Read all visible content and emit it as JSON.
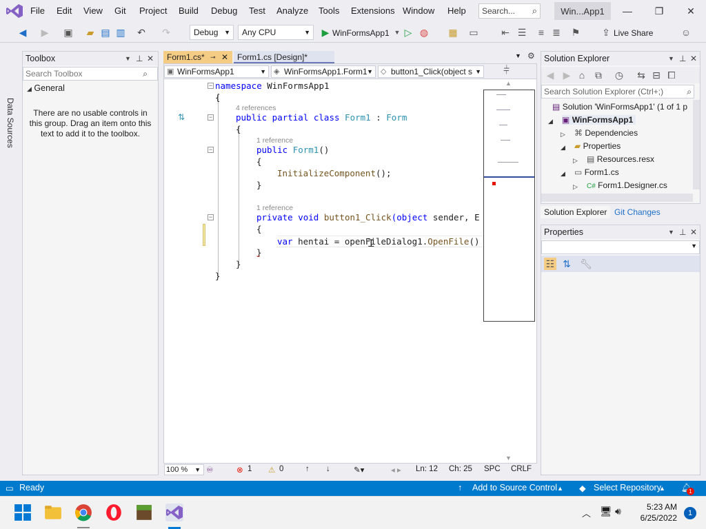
{
  "menubar": {
    "items": [
      "File",
      "Edit",
      "View",
      "Git",
      "Project",
      "Build",
      "Debug",
      "Test",
      "Analyze",
      "Tools",
      "Extensions",
      "Window",
      "Help"
    ],
    "search_placeholder": "Search...",
    "solution_badge": "Win...App1"
  },
  "toolbar": {
    "config": "Debug",
    "platform": "Any CPU",
    "run_target": "WinFormsApp1",
    "live_share": "Live Share"
  },
  "left_strip": {
    "label": "Data Sources"
  },
  "toolbox": {
    "title": "Toolbox",
    "search_placeholder": "Search Toolbox",
    "group": "General",
    "empty_message": "There are no usable controls in this group. Drag an item onto this text to add it to the toolbox."
  },
  "editor": {
    "tabs": [
      {
        "label": "Form1.cs*"
      },
      {
        "label": "Form1.cs [Design]*"
      }
    ],
    "nav": {
      "project": "WinFormsApp1",
      "type": "WinFormsApp1.Form1",
      "member": "button1_Click(object s"
    },
    "code": {
      "line1_kw": "namespace",
      "line1_name": " WinFormsApp1",
      "brace_open": "{",
      "brace_close": "}",
      "hint_4refs": "4 references",
      "class_kw": "public partial class ",
      "class_name": "Form1",
      "class_sep": " : ",
      "class_base": "Form",
      "hint_1ref_a": "1 reference",
      "ctor_kw": "public ",
      "ctor_name": "Form1",
      "ctor_parens": "()",
      "init_call": "InitializeComponent",
      "init_tail": "();",
      "hint_1ref_b": "1 reference",
      "method_kw": "private void ",
      "method_name": "button1_Click",
      "method_params_kw": "(object",
      "method_params": " sender, E",
      "var_kw": "var",
      "var_name": " hentai = openFileDialog1.",
      "var_call": "OpenFile",
      "var_tail": "()"
    },
    "status": {
      "zoom": "100 %",
      "errors": "1",
      "warnings": "0",
      "line": "Ln: 12",
      "col": "Ch: 25",
      "whitespace": "SPC",
      "eol": "CRLF"
    }
  },
  "solution_explorer": {
    "title": "Solution Explorer",
    "search_placeholder": "Search Solution Explorer (Ctrl+;)",
    "tree": [
      {
        "label": "Solution 'WinFormsApp1' (1 of 1 p"
      },
      {
        "label": "WinFormsApp1"
      },
      {
        "label": "Dependencies"
      },
      {
        "label": "Properties"
      },
      {
        "label": "Resources.resx"
      },
      {
        "label": "Form1.cs"
      },
      {
        "label": "Form1.Designer.cs"
      }
    ],
    "tabs": [
      "Solution Explorer",
      "Git Changes"
    ]
  },
  "properties": {
    "title": "Properties"
  },
  "statusbar": {
    "ready": "Ready",
    "source_control": "Add to Source Control",
    "repository": "Select Repository",
    "notifications": "1"
  },
  "taskbar": {
    "time": "5:23 AM",
    "date": "6/25/2022",
    "notification_count": "1"
  },
  "colors": {
    "accent": "#007acc",
    "brand": "#68217a",
    "active_tab": "#f5cc84"
  }
}
